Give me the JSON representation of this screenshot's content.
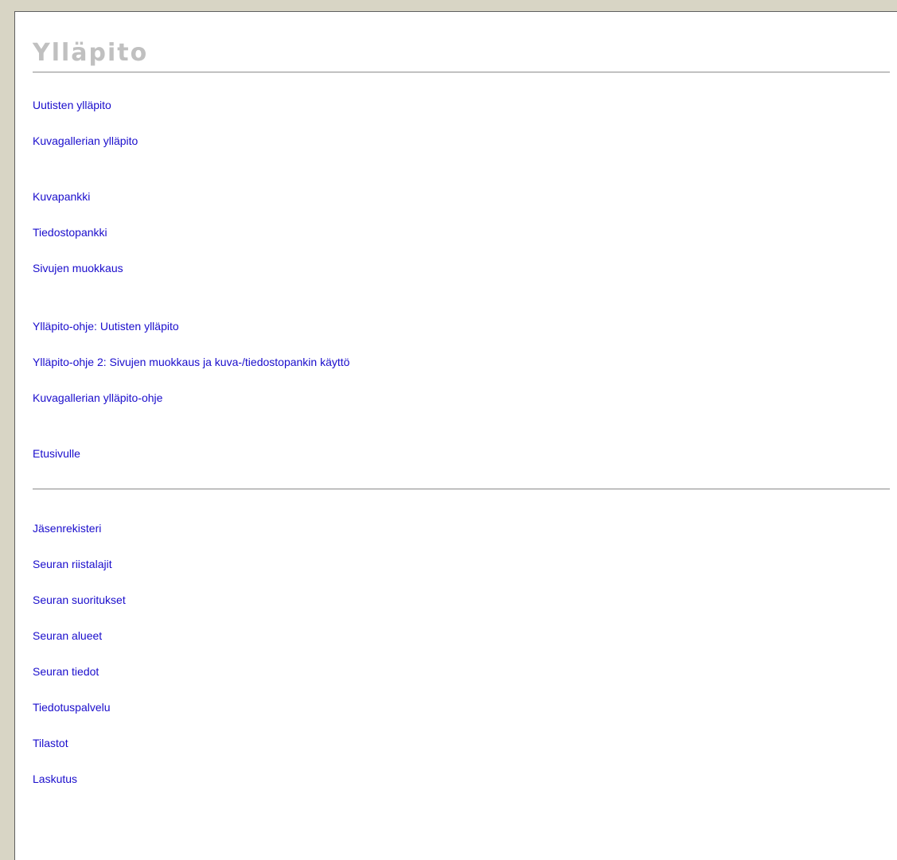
{
  "page": {
    "title": "Ylläpito",
    "colors": {
      "title": "#c0c0c0",
      "link": "#1a0dcc",
      "frame": "#d8d5c5",
      "background": "#ffffff"
    }
  },
  "links": {
    "group1": [
      "Uutisten ylläpito",
      "Kuvagallerian ylläpito"
    ],
    "group2": [
      "Kuvapankki",
      "Tiedostopankki",
      "Sivujen muokkaus"
    ],
    "group3": [
      "Ylläpito-ohje: Uutisten ylläpito",
      "Ylläpito-ohje 2: Sivujen muokkaus ja kuva-/tiedostopankin käyttö",
      "Kuvagallerian ylläpito-ohje"
    ],
    "group4": [
      "Etusivulle"
    ],
    "group5": [
      "Jäsenrekisteri",
      "Seuran riistalajit",
      "Seuran suoritukset",
      "Seuran alueet",
      "Seuran tiedot",
      "Tiedotuspalvelu",
      "Tilastot",
      "Laskutus"
    ]
  }
}
